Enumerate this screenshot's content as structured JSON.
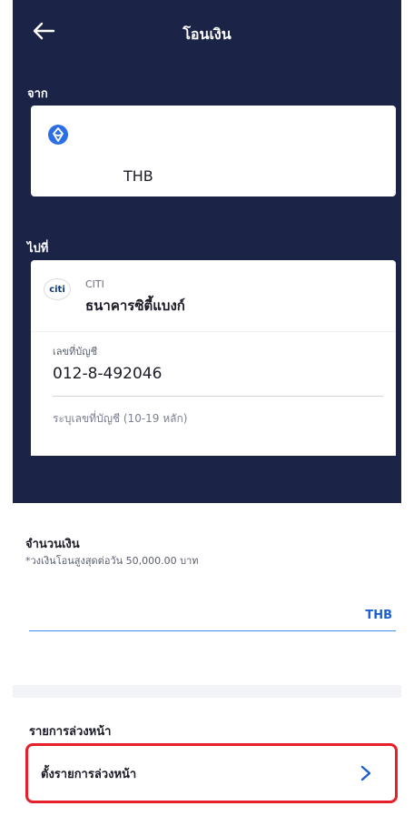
{
  "header": {
    "title": "โอนเงิน",
    "back_icon": "arrow-left-icon"
  },
  "from": {
    "label": "จาก",
    "icon": "coin-icon",
    "currency": "THB"
  },
  "to": {
    "label": "ไปที่",
    "bank_logo_text": "citi",
    "bank_code": "CITI",
    "bank_name": "ธนาคารซิตี้แบงก์",
    "account_label": "เลขที่บัญชี",
    "account_number": "012-8-492046",
    "account_hint": "ระบุเลขที่บัญชี (10-19 หลัก)"
  },
  "amount": {
    "label": "จำนวนเงิน",
    "note": "*วงเงินโอนสูงสุดต่อวัน 50,000.00 บาท",
    "currency": "THB"
  },
  "scheduled": {
    "title": "รายการล่วงหน้า",
    "button_label": "ตั้งรายการล่วงหน้า",
    "chevron_icon": "chevron-right-icon"
  },
  "colors": {
    "navy": "#1b2346",
    "accent_blue": "#1e5fd1",
    "highlight_red": "#e5202a"
  }
}
